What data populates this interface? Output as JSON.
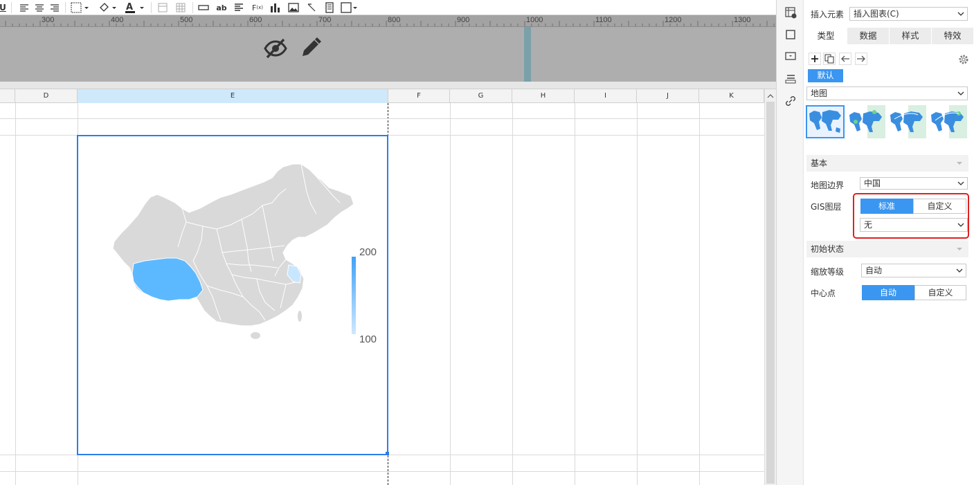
{
  "ruler": {
    "ticks": [
      "300",
      "400",
      "500",
      "600",
      "700",
      "800",
      "900",
      "1000",
      "1100",
      "1200",
      "1300"
    ]
  },
  "columns": [
    "D",
    "E",
    "F",
    "G",
    "H",
    "I",
    "J",
    "K"
  ],
  "chart": {
    "legend_max": "200",
    "legend_min": "100",
    "highlight_color": "#5db9ff",
    "light_color": "#c9e6ff",
    "base_color": "#d9d9d9"
  },
  "band_icons": [
    "eye-slash-icon",
    "pencil-icon"
  ],
  "panel": {
    "insert_label": "插入元素",
    "insert_value": "插入图表(C)",
    "tabs": [
      "类型",
      "数据",
      "样式",
      "特效"
    ],
    "active_tab": "类型",
    "default_tag": "默认",
    "chart_type": "地图",
    "section_basic": "基本",
    "map_boundary_label": "地图边界",
    "map_boundary_value": "中国",
    "gis_label": "GIS图层",
    "gis_options": [
      "标准",
      "自定义"
    ],
    "gis_selected": "标准",
    "gis_layer_value": "无",
    "section_initial": "初始状态",
    "zoom_label": "缩放等级",
    "zoom_value": "自动",
    "center_label": "中心点",
    "center_options": [
      "自动",
      "自定义"
    ],
    "center_selected": "自动"
  },
  "colors": {
    "accent": "#3a96f0",
    "highlight_box": "#e02020",
    "selection_border": "#2b7de9"
  }
}
